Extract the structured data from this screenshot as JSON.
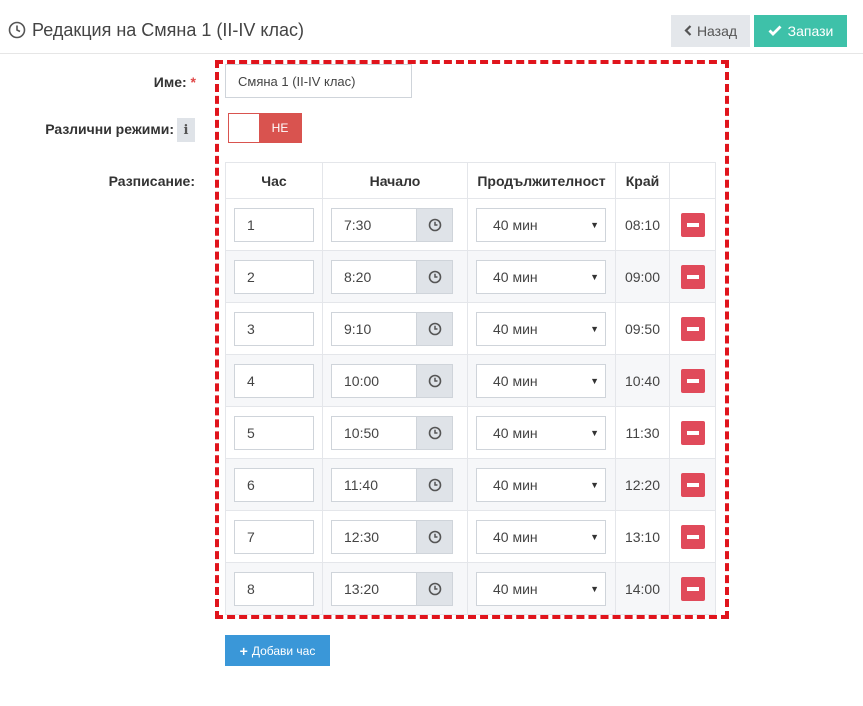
{
  "header": {
    "title": "Редакция на Смяна 1 (II-IV клас)",
    "back_label": "Назад",
    "save_label": "Запази"
  },
  "form": {
    "name_label": "Име:",
    "name_required_mark": "*",
    "name_value": "Смяна 1 (II-IV клас)",
    "modes_label": "Различни режими:",
    "modes_info_icon": "i",
    "modes_toggle_text": "НЕ",
    "schedule_label": "Разписание:"
  },
  "table": {
    "columns": [
      "Час",
      "Начало",
      "Продължителност",
      "Край",
      ""
    ],
    "rows": [
      {
        "hour": "1",
        "start": "7:30",
        "duration": "40 мин",
        "end": "08:10"
      },
      {
        "hour": "2",
        "start": "8:20",
        "duration": "40 мин",
        "end": "09:00"
      },
      {
        "hour": "3",
        "start": "9:10",
        "duration": "40 мин",
        "end": "09:50"
      },
      {
        "hour": "4",
        "start": "10:00",
        "duration": "40 мин",
        "end": "10:40"
      },
      {
        "hour": "5",
        "start": "10:50",
        "duration": "40 мин",
        "end": "11:30"
      },
      {
        "hour": "6",
        "start": "11:40",
        "duration": "40 мин",
        "end": "12:20"
      },
      {
        "hour": "7",
        "start": "12:30",
        "duration": "40 мин",
        "end": "13:10"
      },
      {
        "hour": "8",
        "start": "13:20",
        "duration": "40 мин",
        "end": "14:00"
      }
    ]
  },
  "add_button": {
    "label": "Добави час"
  },
  "colors": {
    "save": "#3ec1a9",
    "toggle_off": "#d9534f",
    "delete": "#e04a5a",
    "add": "#3a97d8",
    "highlight_frame": "#e0141c"
  },
  "icons": {
    "title": "clock-icon",
    "back": "chevron-left-icon",
    "save": "check-icon",
    "time_addon": "clock-icon",
    "delete": "minus-icon",
    "add": "plus-icon"
  }
}
